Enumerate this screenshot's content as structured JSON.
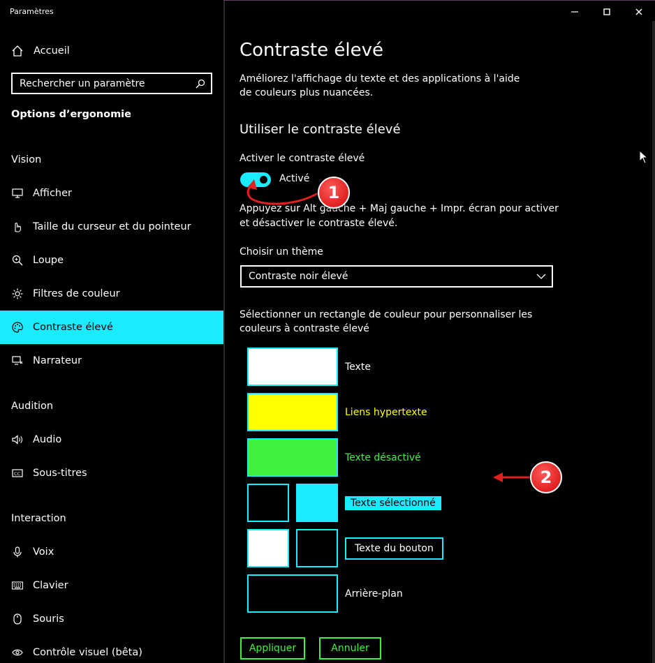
{
  "app": {
    "title": "Paramètres"
  },
  "window": {
    "minimize": "—",
    "maximize": "☐",
    "close": "✕"
  },
  "sidebar": {
    "home": "Accueil",
    "search_placeholder": "Rechercher un paramètre",
    "section": "Options d’ergonomie",
    "groups": {
      "vision": "Vision",
      "audition": "Audition",
      "interaction": "Interaction"
    },
    "items": [
      {
        "label": "Afficher",
        "icon": "monitor-icon"
      },
      {
        "label": "Taille du curseur et du pointeur",
        "icon": "pointer-icon"
      },
      {
        "label": "Loupe",
        "icon": "magnifier-icon"
      },
      {
        "label": "Filtres de couleur",
        "icon": "sun-icon"
      },
      {
        "label": "Contraste élevé",
        "icon": "palette-icon",
        "active": true
      },
      {
        "label": "Narrateur",
        "icon": "narrator-icon"
      },
      {
        "label": "Audio",
        "icon": "speaker-icon"
      },
      {
        "label": "Sous-titres",
        "icon": "captions-icon"
      },
      {
        "label": "Voix",
        "icon": "microphone-icon"
      },
      {
        "label": "Clavier",
        "icon": "keyboard-icon"
      },
      {
        "label": "Souris",
        "icon": "mouse-icon"
      },
      {
        "label": "Contrôle visuel (bêta)",
        "icon": "eye-icon"
      }
    ]
  },
  "main": {
    "title": "Contraste élevé",
    "description": "Améliorez l'affichage du texte et des applications à l'aide de couleurs plus nuancées.",
    "subheading": "Utiliser le contraste élevé",
    "toggle_label": "Activer le contraste élevé",
    "toggle_state": "Activé",
    "toggle_on": true,
    "hint": "Appuyez sur Alt gauche + Maj gauche + Impr. écran pour activer et désactiver le contraste élevé.",
    "theme_label": "Choisir un thème",
    "theme_value": "Contraste noir élevé",
    "select_description": "Sélectionner un rectangle de couleur pour personnaliser les couleurs à contraste élevé",
    "colors": {
      "text": "Texte",
      "hyperlinks": "Liens hypertexte",
      "disabled": "Texte désactivé",
      "selected": "Texte sélectionné",
      "button": "Texte du bouton",
      "background": "Arrière-plan"
    },
    "apply": "Appliquer",
    "cancel": "Annuler"
  },
  "annotations": {
    "badge1": "1",
    "badge2": "2"
  },
  "palette": {
    "accent": "#1aebff",
    "hyperlink": "#ffff00",
    "disabled": "#3ff23f",
    "annotation": "#e02020"
  }
}
